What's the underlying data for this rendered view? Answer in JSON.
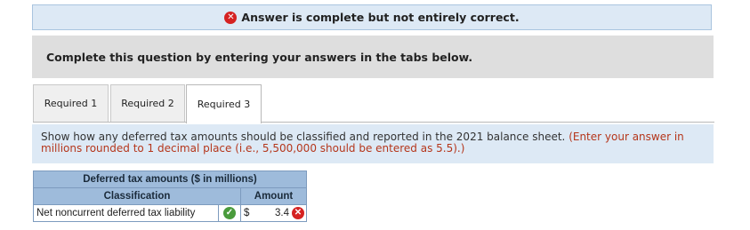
{
  "banner": {
    "text": "Answer is complete but not entirely correct.",
    "icon": "x-circle-icon",
    "icon_color": "#d52222"
  },
  "instructions": {
    "text": "Complete this question by entering your answers in the tabs below."
  },
  "tabs": [
    {
      "label": "Required 1",
      "active": false
    },
    {
      "label": "Required 2",
      "active": false
    },
    {
      "label": "Required 3",
      "active": true
    }
  ],
  "question": {
    "text": "Show how any deferred tax amounts should be classified and reported in the 2021 balance sheet.",
    "note": "(Enter your answer in millions rounded to 1 decimal place (i.e., 5,500,000 should be entered as 5.5).)"
  },
  "table": {
    "title": "Deferred tax amounts ($ in millions)",
    "col_classification": "Classification",
    "col_amount": "Amount",
    "rows": [
      {
        "label": "Net noncurrent deferred tax liability",
        "label_status": "correct",
        "currency": "$",
        "value": "3.4",
        "value_status": "incorrect"
      }
    ]
  },
  "colors": {
    "header_bg": "#9ebbdb",
    "panel_bg": "#dde9f5",
    "correct": "#4a9b3c",
    "incorrect": "#d52222",
    "note": "#b5361b"
  }
}
